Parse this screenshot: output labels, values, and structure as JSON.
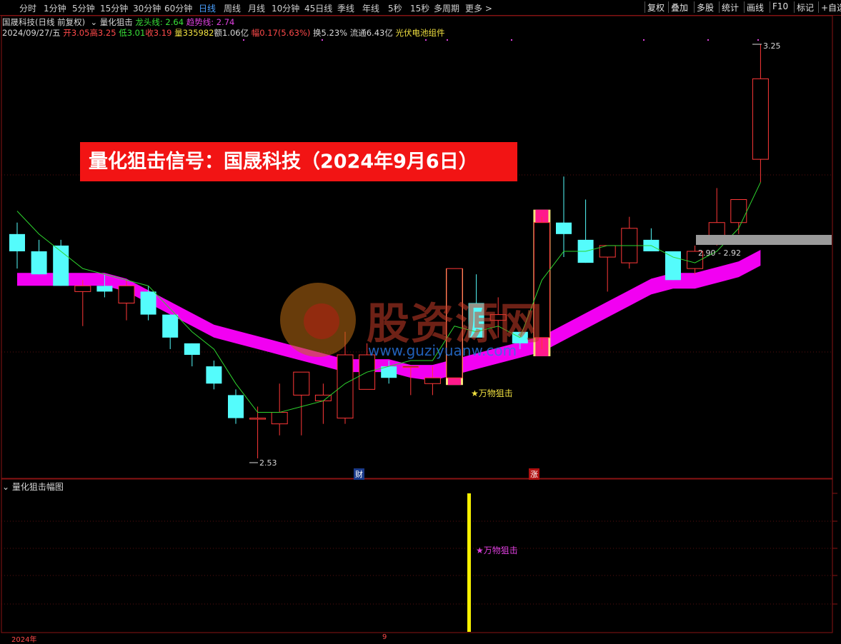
{
  "toolbar": {
    "periods": [
      "分时",
      "1分钟",
      "5分钟",
      "15分钟",
      "30分钟",
      "60分钟",
      "日线",
      "周线",
      "月线",
      "10分钟",
      "45日线",
      "季线",
      "年线",
      "5秒",
      "15秒",
      "多周期",
      "更多 >"
    ],
    "active_period": "日线",
    "right_buttons": [
      "复权",
      "叠加",
      "多股",
      "统计",
      "画线",
      "F10",
      "标记",
      "+自选"
    ]
  },
  "title_line": {
    "stock": "国晟科技(日线 前复权)",
    "indicator": "量化狙击",
    "dragon_label": "龙头线: 2.64",
    "trend_label": "趋势线: 2.74"
  },
  "info_line": {
    "date": "2024/09/27/五",
    "open": "开3.05",
    "high": "高3.25",
    "low": "低3.01",
    "close": "收3.19",
    "volume": "量335982",
    "amount": "额1.06亿",
    "change": "幅0.17(5.63%)",
    "turnover": "换5.23%",
    "float": "流通6.43亿",
    "concept": "光伏电池组件"
  },
  "banner": "量化狙击信号：国晟科技（2024年9月6日）",
  "watermark": {
    "name": "股资源网",
    "url": "www.guziyuanw.com"
  },
  "price_labels": {
    "high": "3.25",
    "low": "2.53",
    "range": "2.90 - 2.92"
  },
  "markers": {
    "cai": "财",
    "zhang": "涨",
    "signal_main": "★万物狙击",
    "signal_sub": "★万物狙击"
  },
  "sub_panel": {
    "title": "量化狙击幅图"
  },
  "bottom_axis": {
    "year": "2024年",
    "month": "9"
  },
  "colors": {
    "up": "#ff3838",
    "down": "#54fcfc",
    "trend_band": "#ff00ff",
    "signal_bar": "#ff1a8c",
    "signal_edge": "#f5e47a",
    "ma_line": "#2ed52e",
    "banner_bg": "#f21414"
  },
  "chart_data": {
    "type": "candlestick",
    "y_range": [
      2.53,
      3.25
    ],
    "candles": [
      {
        "o": 2.92,
        "h": 2.94,
        "l": 2.86,
        "c": 2.89
      },
      {
        "o": 2.89,
        "h": 2.91,
        "l": 2.85,
        "c": 2.85
      },
      {
        "o": 2.9,
        "h": 2.91,
        "l": 2.83,
        "c": 2.83
      },
      {
        "o": 2.82,
        "h": 2.84,
        "l": 2.76,
        "c": 2.83
      },
      {
        "o": 2.83,
        "h": 2.85,
        "l": 2.81,
        "c": 2.82
      },
      {
        "o": 2.8,
        "h": 2.84,
        "l": 2.77,
        "c": 2.83
      },
      {
        "o": 2.82,
        "h": 2.83,
        "l": 2.77,
        "c": 2.78
      },
      {
        "o": 2.78,
        "h": 2.78,
        "l": 2.72,
        "c": 2.74
      },
      {
        "o": 2.73,
        "h": 2.73,
        "l": 2.69,
        "c": 2.71
      },
      {
        "o": 2.69,
        "h": 2.7,
        "l": 2.65,
        "c": 2.66
      },
      {
        "o": 2.64,
        "h": 2.65,
        "l": 2.59,
        "c": 2.6
      },
      {
        "o": 2.6,
        "h": 2.62,
        "l": 2.53,
        "c": 2.6
      },
      {
        "o": 2.59,
        "h": 2.66,
        "l": 2.57,
        "c": 2.61
      },
      {
        "o": 2.64,
        "h": 2.67,
        "l": 2.57,
        "c": 2.68
      },
      {
        "o": 2.63,
        "h": 2.66,
        "l": 2.59,
        "c": 2.64
      },
      {
        "o": 2.6,
        "h": 2.75,
        "l": 2.59,
        "c": 2.71
      },
      {
        "o": 2.65,
        "h": 2.73,
        "l": 2.65,
        "c": 2.71
      },
      {
        "o": 2.69,
        "h": 2.7,
        "l": 2.66,
        "c": 2.67
      },
      {
        "o": 2.69,
        "h": 2.69,
        "l": 2.64,
        "c": 2.69
      },
      {
        "o": 2.66,
        "h": 2.69,
        "l": 2.64,
        "c": 2.67
      },
      {
        "o": 2.67,
        "h": 2.86,
        "l": 2.67,
        "c": 2.86
      },
      {
        "o": 2.8,
        "h": 2.85,
        "l": 2.78,
        "c": 2.74
      },
      {
        "o": 2.77,
        "h": 2.81,
        "l": 2.74,
        "c": 2.78
      },
      {
        "o": 2.75,
        "h": 2.75,
        "l": 2.72,
        "c": 2.73
      },
      {
        "o": 2.74,
        "h": 2.95,
        "l": 2.72,
        "c": 2.94
      },
      {
        "o": 2.94,
        "h": 3.02,
        "l": 2.88,
        "c": 2.92
      },
      {
        "o": 2.91,
        "h": 2.98,
        "l": 2.87,
        "c": 2.87
      },
      {
        "o": 2.88,
        "h": 2.9,
        "l": 2.82,
        "c": 2.9
      },
      {
        "o": 2.87,
        "h": 2.95,
        "l": 2.86,
        "c": 2.93
      },
      {
        "o": 2.91,
        "h": 2.93,
        "l": 2.89,
        "c": 2.89
      },
      {
        "o": 2.89,
        "h": 2.89,
        "l": 2.84,
        "c": 2.84
      },
      {
        "o": 2.86,
        "h": 2.9,
        "l": 2.85,
        "c": 2.89
      },
      {
        "o": 2.91,
        "h": 3.0,
        "l": 2.9,
        "c": 2.94
      },
      {
        "o": 2.94,
        "h": 2.98,
        "l": 2.92,
        "c": 2.98
      },
      {
        "o": 3.05,
        "h": 3.25,
        "l": 3.01,
        "c": 3.19
      }
    ],
    "ma_line": [
      2.96,
      2.92,
      2.89,
      2.86,
      2.85,
      2.84,
      2.83,
      2.79,
      2.75,
      2.72,
      2.66,
      2.61,
      2.61,
      2.62,
      2.63,
      2.66,
      2.68,
      2.69,
      2.7,
      2.7,
      2.76,
      2.75,
      2.76,
      2.74,
      2.84,
      2.89,
      2.89,
      2.9,
      2.9,
      2.9,
      2.88,
      2.87,
      2.89,
      2.93,
      3.01
    ],
    "trend_band": [
      2.84,
      2.84,
      2.84,
      2.84,
      2.84,
      2.83,
      2.81,
      2.79,
      2.77,
      2.75,
      2.74,
      2.73,
      2.72,
      2.71,
      2.7,
      2.69,
      2.69,
      2.69,
      2.68,
      2.68,
      2.69,
      2.7,
      2.71,
      2.72,
      2.73,
      2.75,
      2.77,
      2.79,
      2.81,
      2.83,
      2.84,
      2.84,
      2.85,
      2.86,
      2.88
    ],
    "signal_bars": [
      20,
      24
    ],
    "sub_signal_index": 21
  }
}
